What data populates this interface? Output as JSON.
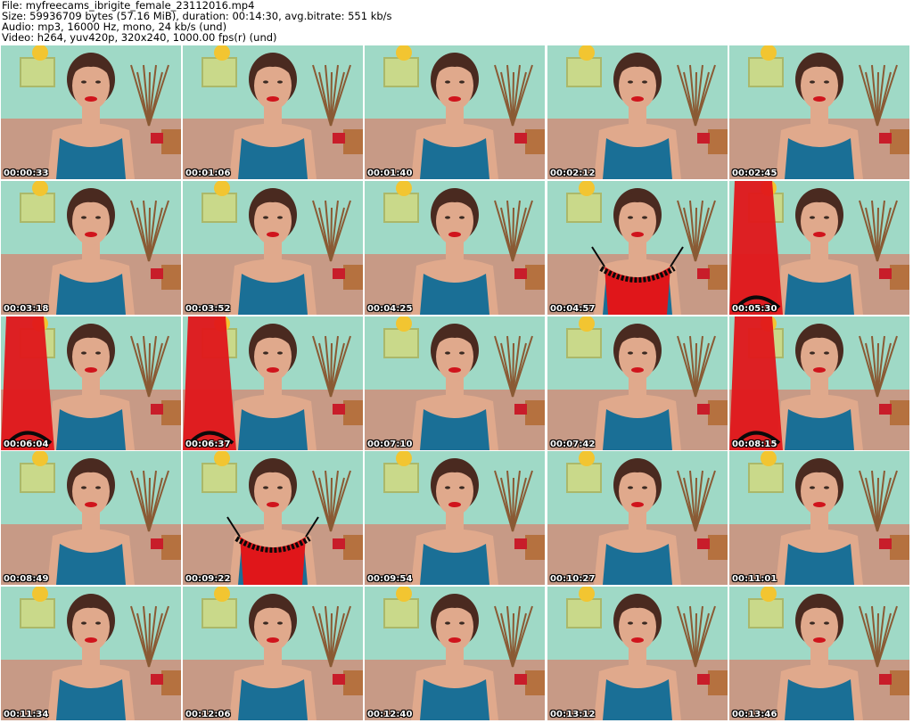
{
  "header": {
    "file_line": "File: myfreecams_ibrigite_female_23112016.mp4",
    "size_line": "Size: 59936709 bytes (57.16 MiB), duration: 00:14:30, avg.bitrate: 551 kb/s",
    "audio_line": "Audio: mp3, 16000 Hz, mono, 24 kb/s (und)",
    "video_line": "Video: h264, yuv420p, 320x240, 1000.00 fps(r) (und)"
  },
  "colors": {
    "wall": "#9fd9c6",
    "top": "#1a6f96",
    "skin": "#e0a98c",
    "hair": "#4a2a20",
    "garment": "#e0161a",
    "lace": "#0a0a0a",
    "frame": "#c9d98a",
    "sofa": "#c79a86"
  },
  "thumbnails": [
    {
      "time": "00:00:33",
      "prop": "none"
    },
    {
      "time": "00:01:06",
      "prop": "none"
    },
    {
      "time": "00:01:40",
      "prop": "none"
    },
    {
      "time": "00:02:12",
      "prop": "none"
    },
    {
      "time": "00:02:45",
      "prop": "none"
    },
    {
      "time": "00:03:18",
      "prop": "none"
    },
    {
      "time": "00:03:52",
      "prop": "none"
    },
    {
      "time": "00:04:25",
      "prop": "none"
    },
    {
      "time": "00:04:57",
      "prop": "lingerie"
    },
    {
      "time": "00:05:30",
      "prop": "dress"
    },
    {
      "time": "00:06:04",
      "prop": "dress"
    },
    {
      "time": "00:06:37",
      "prop": "dress"
    },
    {
      "time": "00:07:10",
      "prop": "none"
    },
    {
      "time": "00:07:42",
      "prop": "none"
    },
    {
      "time": "00:08:15",
      "prop": "dress"
    },
    {
      "time": "00:08:49",
      "prop": "none"
    },
    {
      "time": "00:09:22",
      "prop": "lingerie"
    },
    {
      "time": "00:09:54",
      "prop": "none"
    },
    {
      "time": "00:10:27",
      "prop": "none"
    },
    {
      "time": "00:11:01",
      "prop": "none"
    },
    {
      "time": "00:11:34",
      "prop": "none"
    },
    {
      "time": "00:12:06",
      "prop": "none"
    },
    {
      "time": "00:12:40",
      "prop": "none"
    },
    {
      "time": "00:13:12",
      "prop": "none"
    },
    {
      "time": "00:13:46",
      "prop": "none"
    }
  ]
}
